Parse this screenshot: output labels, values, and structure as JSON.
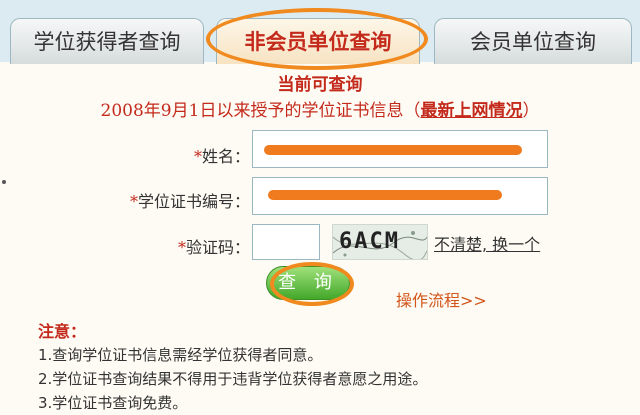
{
  "tabs": [
    {
      "label": "学位获得者查询"
    },
    {
      "label": "非会员单位查询"
    },
    {
      "label": "会员单位查询"
    }
  ],
  "header": {
    "line1": "当前可查询",
    "line2": "2008年9月1日以来授予的学位证书信息（",
    "link": "最新上网情况",
    "close": "）"
  },
  "form": {
    "name_label": "姓名：",
    "cert_label": "学位证书编号：",
    "code_label": "验证码：",
    "required_mark": "*",
    "captcha_text": "6ACM",
    "unclear_link": "不清楚, 换一个",
    "submit": "查 询",
    "flow_link": "操作流程>>"
  },
  "notes": {
    "title": "注意：",
    "items": [
      "1.查询学位证书信息需经学位获得者同意。",
      "2.学位证书查询结果不得用于违背学位获得者意愿之用途。",
      "3.学位证书查询免费。"
    ]
  },
  "colors": {
    "accent": "#c42a1c",
    "highlight": "#f08a1e",
    "button": "#43a82a"
  }
}
